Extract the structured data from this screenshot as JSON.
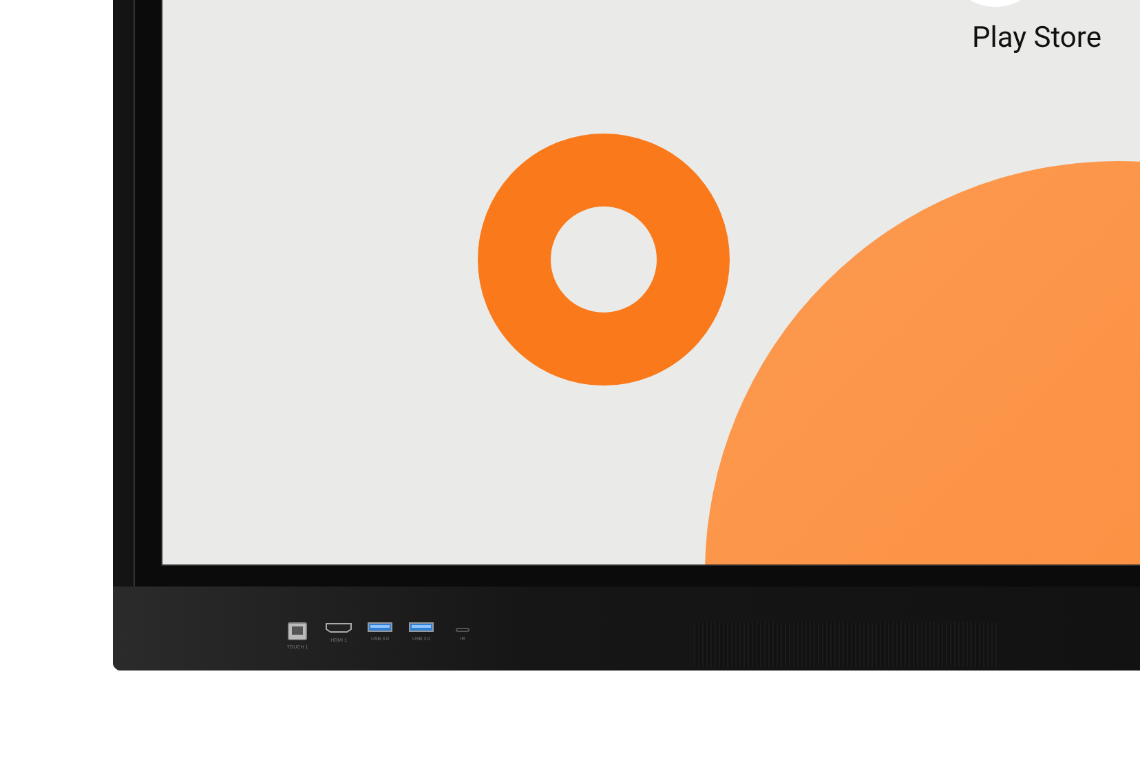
{
  "screen": {
    "app_label": "Play Store"
  },
  "ports": [
    {
      "kind": "usb-b",
      "label": "TOUCH 1"
    },
    {
      "kind": "hdmi",
      "label": "HDMI 1"
    },
    {
      "kind": "usb-a",
      "label": "USB 3.0"
    },
    {
      "kind": "usb-a",
      "label": "USB 3.0"
    },
    {
      "kind": "slot",
      "label": "IR"
    }
  ]
}
